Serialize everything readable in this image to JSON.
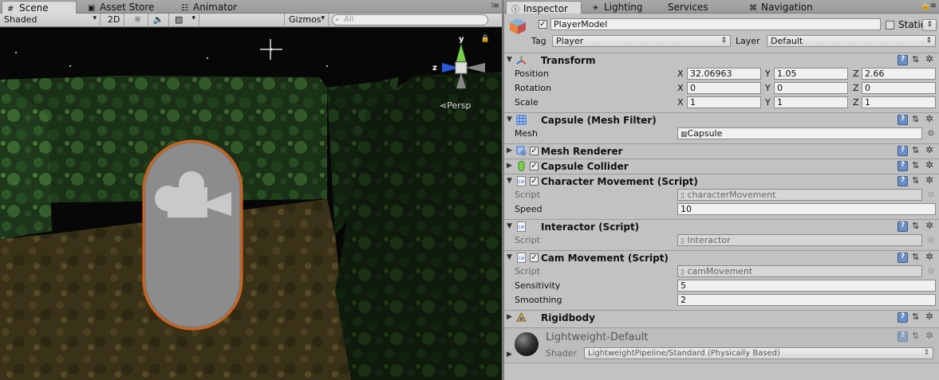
{
  "left_tabs": [
    {
      "label": "Scene",
      "icon": "hash-icon",
      "active": true
    },
    {
      "label": "Asset Store",
      "icon": "bag-icon",
      "active": false
    },
    {
      "label": "Animator",
      "icon": "animator-icon",
      "active": false
    }
  ],
  "scene_toolbar": {
    "shading": "Shaded",
    "mode_2d": "2D",
    "gizmos": "Gizmos",
    "search_placeholder": "All"
  },
  "viewport": {
    "gizmo_y": "y",
    "gizmo_z": "z",
    "persp": "Persp"
  },
  "right_tabs": [
    {
      "label": "Inspector",
      "icon": "info-icon",
      "active": true
    },
    {
      "label": "Lighting",
      "icon": "bulb-icon",
      "active": false
    },
    {
      "label": "Services",
      "icon": "cloud-icon",
      "active": false
    },
    {
      "label": "Navigation",
      "icon": "nav-icon",
      "active": false
    }
  ],
  "object": {
    "name": "PlayerModel",
    "static_label": "Static",
    "tag_label": "Tag",
    "tag_value": "Player",
    "layer_label": "Layer",
    "layer_value": "Default"
  },
  "transform": {
    "title": "Transform",
    "position_label": "Position",
    "rotation_label": "Rotation",
    "scale_label": "Scale",
    "axis_x": "X",
    "axis_y": "Y",
    "axis_z": "Z",
    "position": {
      "x": "32.06963",
      "y": "1.05",
      "z": "2.66"
    },
    "rotation": {
      "x": "0",
      "y": "0",
      "z": "0"
    },
    "scale": {
      "x": "1",
      "y": "1",
      "z": "1"
    }
  },
  "mesh_filter": {
    "title": "Capsule (Mesh Filter)",
    "mesh_label": "Mesh",
    "mesh_value": "Capsule"
  },
  "mesh_renderer": {
    "title": "Mesh Renderer"
  },
  "capsule_collider": {
    "title": "Capsule Collider"
  },
  "character_movement": {
    "title": "Character Movement (Script)",
    "script_label": "Script",
    "script_value": "characterMovement",
    "speed_label": "Speed",
    "speed_value": "10"
  },
  "interactor": {
    "title": "Interactor (Script)",
    "script_label": "Script",
    "script_value": "Interactor"
  },
  "cam_movement": {
    "title": "Cam Movement (Script)",
    "script_label": "Script",
    "script_value": "camMovement",
    "sensitivity_label": "Sensitivity",
    "sensitivity_value": "5",
    "smoothing_label": "Smoothing",
    "smoothing_value": "2"
  },
  "rigidbody": {
    "title": "Rigidbody"
  },
  "material": {
    "name": "Lightweight-Default",
    "shader_label": "Shader",
    "shader_value": "LightweightPipeline/Standard (Physically Based)"
  }
}
